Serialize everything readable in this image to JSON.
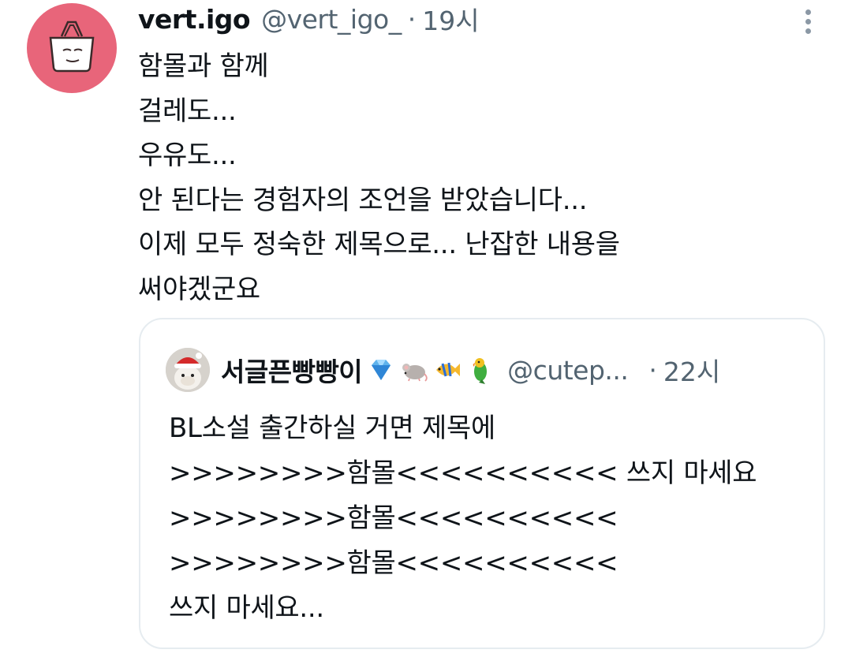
{
  "tweet": {
    "author": {
      "display_name": "vert.igo",
      "handle": "@vert_igo_",
      "time": "19시"
    },
    "separator": "·",
    "avatar_icon": "bag-face-icon",
    "avatar_color": "#e8657a",
    "more_icon": "more-vertical-icon",
    "lines": [
      "함몰과 함께",
      "걸레도...",
      "우유도...",
      "안 된다는 경험자의 조언을 받았습니다...",
      "이제 모두 정숙한 제목으로... 난잡한 내용을",
      "써야겠군요"
    ]
  },
  "quoted_tweet": {
    "author": {
      "display_name": "서글픈빵빵이",
      "handle": "@cutep...",
      "time": "22시"
    },
    "separator": "·",
    "avatar_icon": "hamster-santa-hat-icon",
    "name_emojis": [
      "gem-icon",
      "mouse-icon",
      "tropical-fish-icon",
      "parrot-icon"
    ],
    "lines": [
      "BL소설 출간하실 거면 제목에",
      ">>>>>>>>함몰<<<<<<<<<< 쓰지 마세요",
      ">>>>>>>>함몰<<<<<<<<<<",
      ">>>>>>>>함몰<<<<<<<<<<",
      "쓰지 마세요..."
    ]
  },
  "colors": {
    "text_primary": "#0f1419",
    "text_secondary": "#536471",
    "border": "#e6ecf0"
  }
}
